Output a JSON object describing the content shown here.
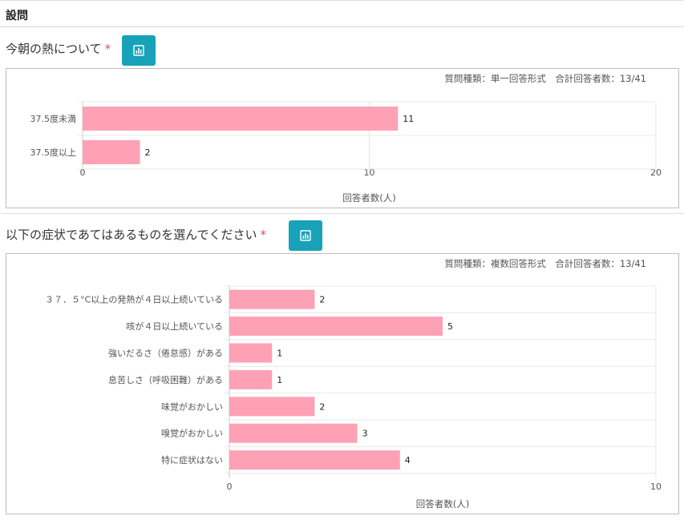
{
  "header": {
    "title": "設問"
  },
  "questions": [
    {
      "label": "今朝の熱について",
      "required_mark": "*",
      "chart_button_icon": "bar-chart-icon",
      "info": {
        "type": "質問種類：単一回答形式",
        "total": "合計回答者数：13/41"
      }
    },
    {
      "label": "以下の症状であてはあるものを選んでください",
      "required_mark": "*",
      "chart_button_icon": "bar-chart-icon",
      "info": {
        "type": "質問種類：複数回答形式",
        "total": "合計回答者数：13/41"
      }
    }
  ],
  "chart_data": [
    {
      "type": "bar",
      "orientation": "horizontal",
      "categories": [
        "37.5度未満",
        "37.5度以上"
      ],
      "values": [
        11,
        2
      ],
      "xlabel": "回答者数(人)",
      "xlim": [
        0,
        20
      ],
      "xticks": [
        "0",
        "10",
        "20"
      ],
      "grid": true,
      "bar_color": "#ffa1b5"
    },
    {
      "type": "bar",
      "orientation": "horizontal",
      "categories": [
        "３７．５°C以上の発熱が４日以上続いている",
        "咳が４日以上続いている",
        "強いだるさ（倦怠感）がある",
        "息苦しさ（呼吸困難）がある",
        "味覚がおかしい",
        "嗅覚がおかしい",
        "特に症状はない"
      ],
      "values": [
        2,
        5,
        1,
        1,
        2,
        3,
        4
      ],
      "xlabel": "回答者数(人)",
      "xlim": [
        0,
        10
      ],
      "xticks": [
        "0",
        "10"
      ],
      "grid": true,
      "bar_color": "#ffa1b5"
    }
  ]
}
